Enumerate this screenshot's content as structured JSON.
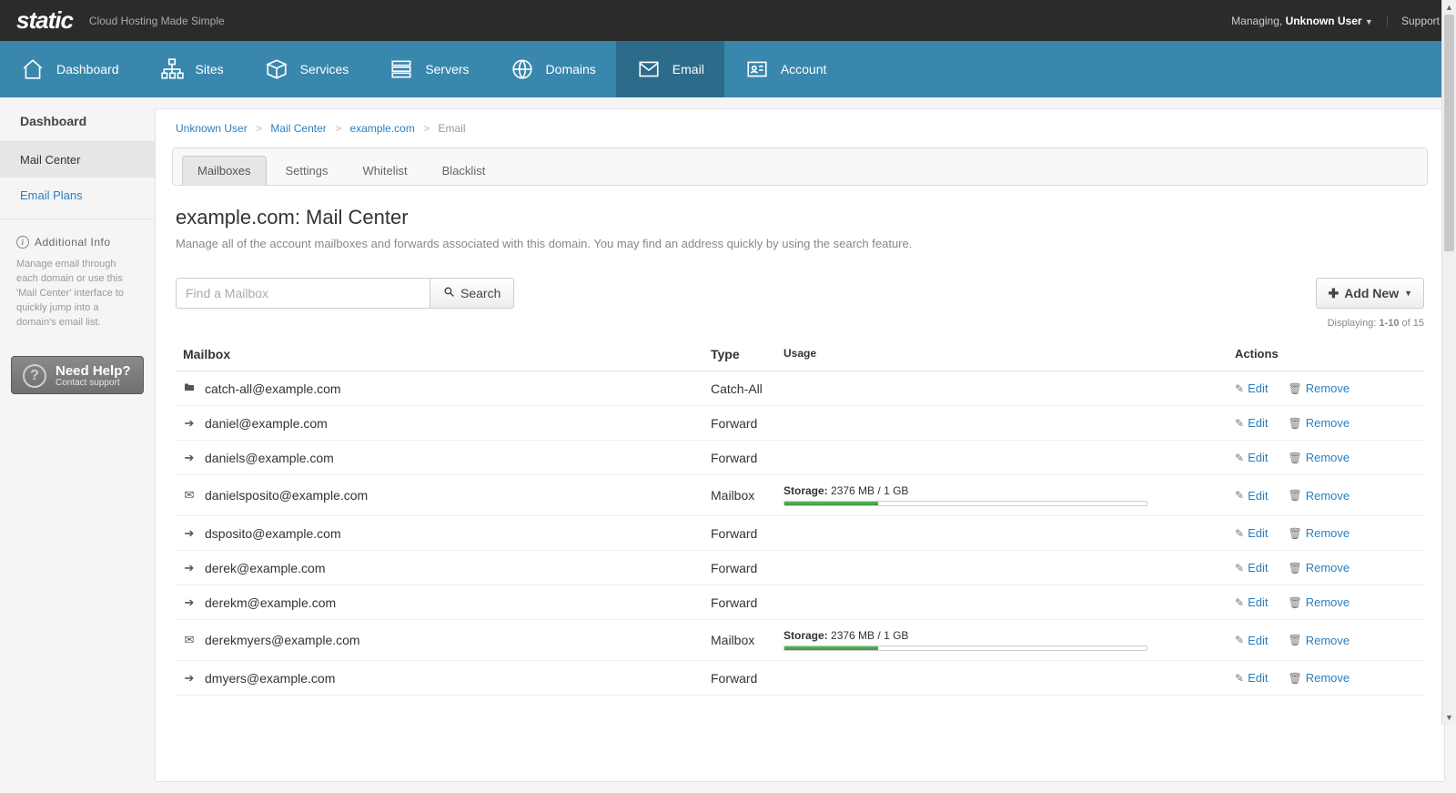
{
  "topbar": {
    "logo": "static",
    "tagline": "Cloud Hosting Made Simple",
    "managing_label": "Managing,",
    "user": "Unknown User",
    "support": "Support"
  },
  "nav": {
    "items": [
      {
        "label": "Dashboard"
      },
      {
        "label": "Sites"
      },
      {
        "label": "Services"
      },
      {
        "label": "Servers"
      },
      {
        "label": "Domains"
      },
      {
        "label": "Email"
      },
      {
        "label": "Account"
      }
    ]
  },
  "sidebar": {
    "heading": "Dashboard",
    "items": [
      {
        "label": "Mail Center"
      },
      {
        "label": "Email Plans"
      }
    ],
    "additional_title": "Additional Info",
    "additional_text": "Manage email through each domain or use this 'Mail Center' interface to quickly jump into a domain's email list.",
    "help_title": "Need Help?",
    "help_sub": "Contact support"
  },
  "breadcrumb": {
    "c0": "Unknown User",
    "c1": "Mail Center",
    "c2": "example.com",
    "c3": "Email"
  },
  "tabs": {
    "t0": "Mailboxes",
    "t1": "Settings",
    "t2": "Whitelist",
    "t3": "Blacklist"
  },
  "page": {
    "title": "example.com: Mail Center",
    "desc": "Manage all of the account mailboxes and forwards associated with this domain. You may find an address quickly by using the search feature."
  },
  "search": {
    "placeholder": "Find a Mailbox",
    "button": "Search"
  },
  "add_button": "Add New",
  "displaying": {
    "prefix": "Displaying: ",
    "range": "1-10",
    "of": " of ",
    "total": "15"
  },
  "columns": {
    "mailbox": "Mailbox",
    "type": "Type",
    "usage": "Usage",
    "actions": "Actions"
  },
  "actions": {
    "edit": "Edit",
    "remove": "Remove"
  },
  "usage_label": "Storage:",
  "rows": [
    {
      "icon": "folder",
      "address": "catch-all@example.com",
      "type": "Catch-All",
      "usage": null
    },
    {
      "icon": "arrow",
      "address": "daniel@example.com",
      "type": "Forward",
      "usage": null
    },
    {
      "icon": "arrow",
      "address": "daniels@example.com",
      "type": "Forward",
      "usage": null
    },
    {
      "icon": "mail",
      "address": "danielsposito@example.com",
      "type": "Mailbox",
      "usage": {
        "text": "2376 MB / 1 GB",
        "pct": 26
      }
    },
    {
      "icon": "arrow",
      "address": "dsposito@example.com",
      "type": "Forward",
      "usage": null
    },
    {
      "icon": "arrow",
      "address": "derek@example.com",
      "type": "Forward",
      "usage": null
    },
    {
      "icon": "arrow",
      "address": "derekm@example.com",
      "type": "Forward",
      "usage": null
    },
    {
      "icon": "mail",
      "address": "derekmyers@example.com",
      "type": "Mailbox",
      "usage": {
        "text": "2376 MB / 1 GB",
        "pct": 26
      }
    },
    {
      "icon": "arrow",
      "address": "dmyers@example.com",
      "type": "Forward",
      "usage": null
    }
  ]
}
